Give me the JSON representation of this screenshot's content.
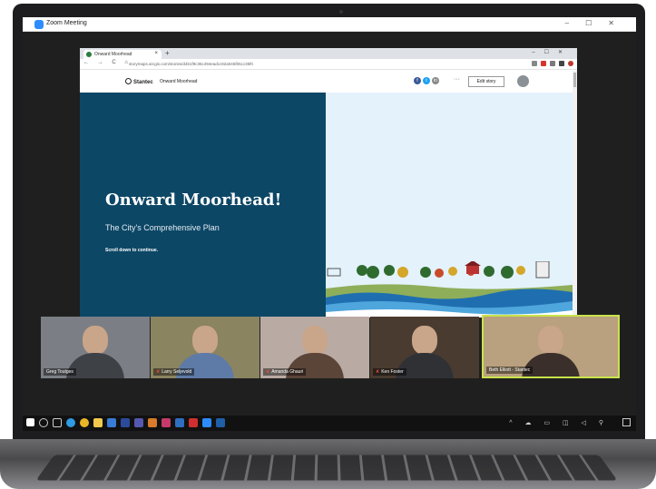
{
  "zoom": {
    "title": "Zoom Meeting",
    "window_controls": [
      "–",
      "☐",
      "✕"
    ]
  },
  "browser": {
    "tab_title": "Onward Moorhead",
    "tab_close": "×",
    "new_tab": "+",
    "window_controls": [
      "–",
      "☐",
      "✕"
    ],
    "nav": [
      "←",
      "→",
      "C",
      "⌂"
    ],
    "url": "storymaps.arcgis.com/stories/d4b1f9c35c494eadcc82a045f05cc35f0"
  },
  "site": {
    "logo": "Stantec",
    "title": "Onward Moorhead",
    "more": "···",
    "edit_story": "Edit story",
    "social": [
      "f",
      "t",
      "in"
    ]
  },
  "hero": {
    "title": "Onward Moorhead!",
    "subtitle": "The City's Comprehensive Plan",
    "scroll_hint": "Scroll down to continue."
  },
  "participants": [
    {
      "name": "Greg Toutges",
      "muted": false,
      "bg": "#7b7f85",
      "shirt": "#3e4247"
    },
    {
      "name": "Larry Seljevold",
      "muted": true,
      "bg": "#8a8460",
      "shirt": "#5e7aa7"
    },
    {
      "name": "Amanda Ghauri",
      "muted": true,
      "bg": "#b9aaa3",
      "shirt": "#5b4438"
    },
    {
      "name": "Ken Foster",
      "muted": true,
      "bg": "#4a3b30",
      "shirt": "#2f3135"
    },
    {
      "name": "Beth Elliott - Stantec",
      "muted": false,
      "bg": "#b9a07e",
      "shirt": "#3b2f2b"
    }
  ],
  "taskbar": {
    "tray": "^ ☁ ▭ ◫ ◁ ⚲"
  },
  "colors": {
    "hero_dark": "#0d4766",
    "hero_light": "#e4f2fb",
    "active_speaker": "#c7e34a",
    "zoom_blue": "#2d8cff"
  }
}
